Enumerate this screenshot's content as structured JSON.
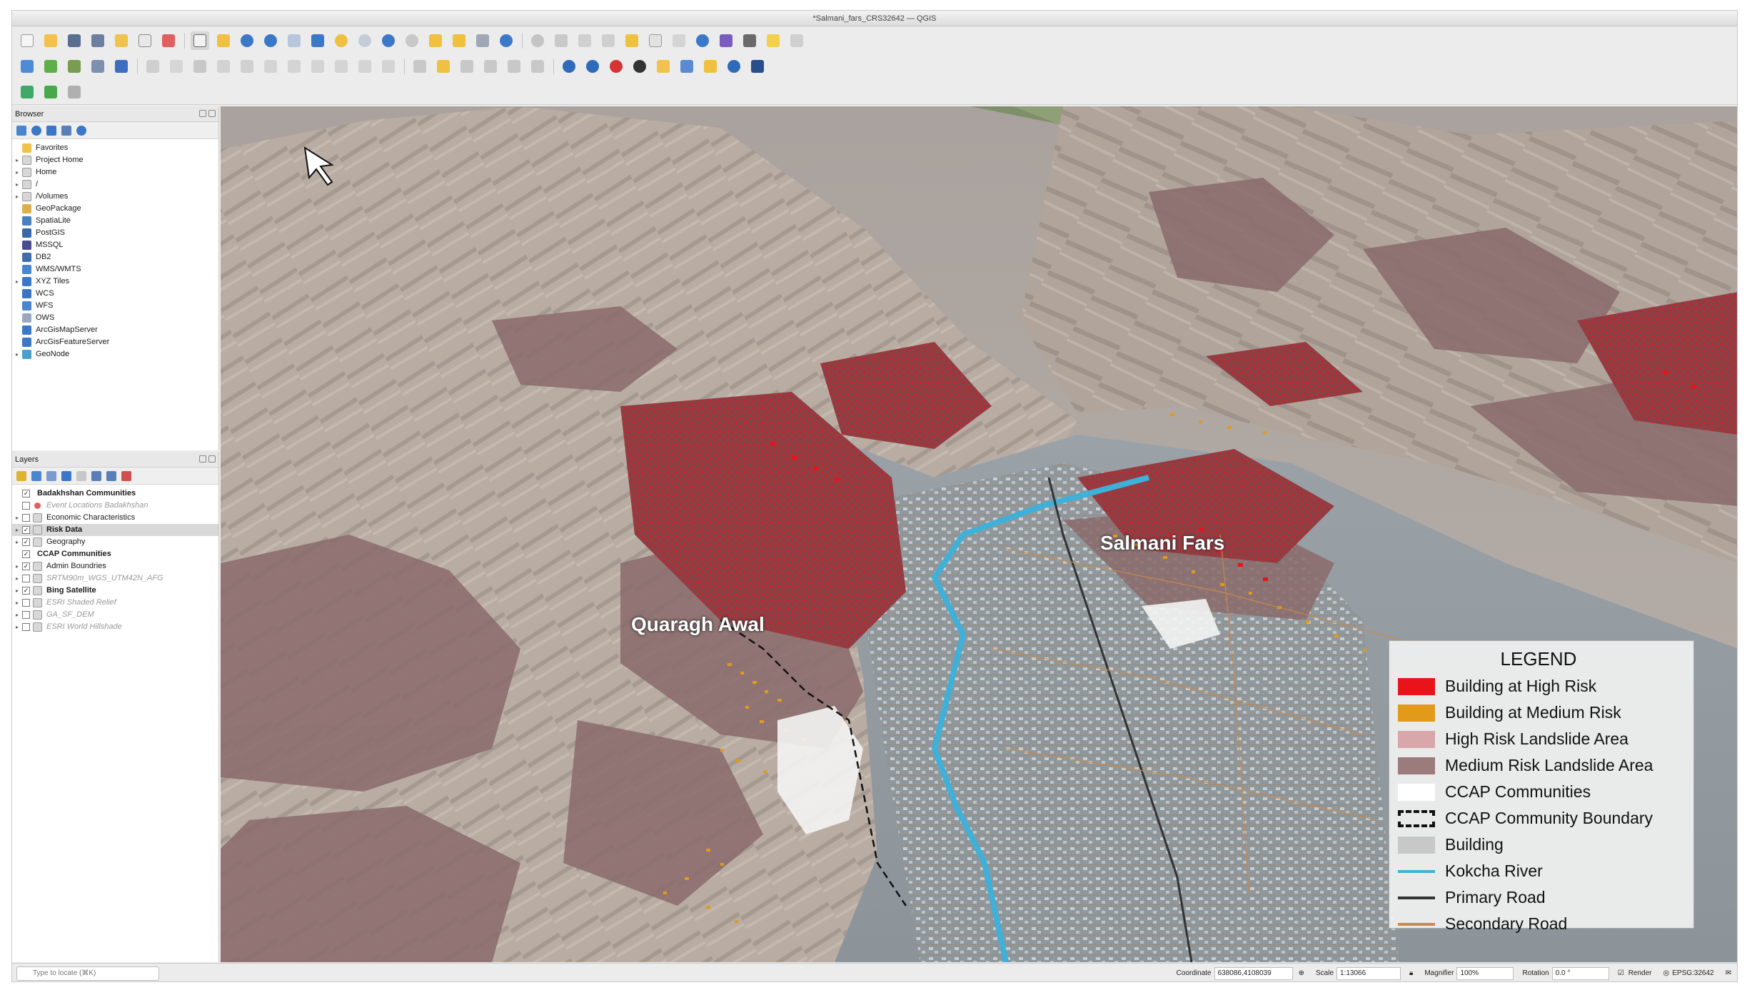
{
  "window": {
    "title": "*Salmani_fars_CRS32642 — QGIS"
  },
  "browser": {
    "title": "Browser",
    "items": [
      {
        "label": "Favorites",
        "icon": "star-icon",
        "expand": false
      },
      {
        "label": "Project Home",
        "icon": "folder-icon",
        "expand": true
      },
      {
        "label": "Home",
        "icon": "folder-icon",
        "expand": true
      },
      {
        "label": "/",
        "icon": "folder-icon",
        "expand": true
      },
      {
        "label": "/Volumes",
        "icon": "folder-icon",
        "expand": true
      },
      {
        "label": "GeoPackage",
        "icon": "geopackage-icon",
        "expand": false
      },
      {
        "label": "SpatiaLite",
        "icon": "spatialite-icon",
        "expand": false
      },
      {
        "label": "PostGIS",
        "icon": "postgis-icon",
        "expand": false
      },
      {
        "label": "MSSQL",
        "icon": "mssql-icon",
        "expand": false
      },
      {
        "label": "DB2",
        "icon": "db2-icon",
        "expand": false
      },
      {
        "label": "WMS/WMTS",
        "icon": "wms-icon",
        "expand": false
      },
      {
        "label": "XYZ Tiles",
        "icon": "xyz-tiles-icon",
        "expand": true
      },
      {
        "label": "WCS",
        "icon": "wcs-icon",
        "expand": false
      },
      {
        "label": "WFS",
        "icon": "wfs-icon",
        "expand": false
      },
      {
        "label": "OWS",
        "icon": "ows-icon",
        "expand": false
      },
      {
        "label": "ArcGisMapServer",
        "icon": "arcgis-icon",
        "expand": false
      },
      {
        "label": "ArcGisFeatureServer",
        "icon": "arcgis-icon",
        "expand": false
      },
      {
        "label": "GeoNode",
        "icon": "geonode-icon",
        "expand": true
      }
    ]
  },
  "layers": {
    "title": "Layers",
    "items": [
      {
        "label": "Badakhshan Communities",
        "checked": true,
        "style": "bold",
        "expand": false,
        "selected": false
      },
      {
        "label": "Event Locations Badakhshan",
        "checked": false,
        "style": "dim",
        "expand": false,
        "selected": false
      },
      {
        "label": "Economic Characteristics",
        "checked": false,
        "style": "normal",
        "expand": true,
        "selected": false
      },
      {
        "label": "Risk Data",
        "checked": true,
        "style": "bold",
        "expand": true,
        "selected": true
      },
      {
        "label": "Geography",
        "checked": true,
        "style": "normal",
        "expand": true,
        "selected": false
      },
      {
        "label": "CCAP Communities",
        "checked": true,
        "style": "bold",
        "expand": false,
        "selected": false
      },
      {
        "label": "Admin Boundries",
        "checked": true,
        "style": "normal",
        "expand": true,
        "selected": false
      },
      {
        "label": "SRTM90m_WGS_UTM42N_AFG",
        "checked": false,
        "style": "dim",
        "expand": true,
        "selected": false
      },
      {
        "label": "Bing Satellite",
        "checked": true,
        "style": "bold",
        "expand": true,
        "selected": false
      },
      {
        "label": "ESRI Shaded Relief",
        "checked": false,
        "style": "dim",
        "expand": true,
        "selected": false
      },
      {
        "label": "GA_SF_DEM",
        "checked": false,
        "style": "dim",
        "expand": true,
        "selected": false
      },
      {
        "label": "ESRI World Hillshade",
        "checked": false,
        "style": "dim",
        "expand": true,
        "selected": false
      }
    ]
  },
  "map": {
    "labels": {
      "quaragh": "Quaragh Awal",
      "salmani": "Salmani Fars"
    }
  },
  "legend": {
    "title": "LEGEND",
    "items": [
      {
        "label": "Building at High Risk",
        "color": "#e8141a",
        "kind": "fill"
      },
      {
        "label": "Building at Medium Risk",
        "color": "#e29a1b",
        "kind": "fill"
      },
      {
        "label": "High Risk Landslide Area",
        "color": "#d9a6aa",
        "kind": "fill"
      },
      {
        "label": "Medium Risk Landslide Area",
        "color": "#9b7b7b",
        "kind": "fill"
      },
      {
        "label": "CCAP Communities",
        "color": "#ffffff",
        "kind": "fill"
      },
      {
        "label": "CCAP Community Boundary",
        "color": "#111111",
        "kind": "dashed"
      },
      {
        "label": "Building",
        "color": "#c8c8c8",
        "kind": "fill"
      },
      {
        "label": "Kokcha River",
        "color": "#3fb0d8",
        "kind": "line"
      },
      {
        "label": "Primary Road",
        "color": "#333333",
        "kind": "line"
      },
      {
        "label": "Secondary Road",
        "color": "#c98a4a",
        "kind": "line"
      }
    ]
  },
  "statusbar": {
    "locate_placeholder": "Type to locate (⌘K)",
    "coordinate_label": "Coordinate",
    "coordinate_value": "638086,4108039",
    "scale_label": "Scale",
    "scale_value": "1:13066",
    "magnifier_label": "Magnifier",
    "magnifier_value": "100%",
    "rotation_label": "Rotation",
    "rotation_value": "0.0 °",
    "render_label": "Render",
    "crs_label": "EPSG:32642"
  }
}
